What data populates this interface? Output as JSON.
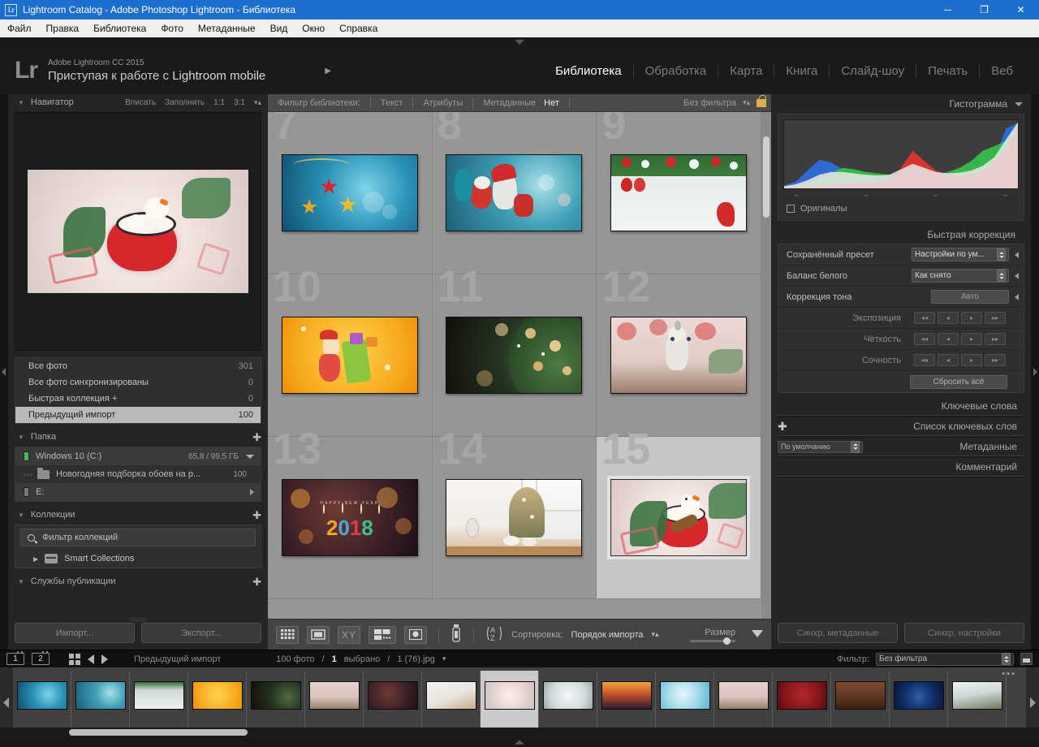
{
  "window": {
    "title": "Lightroom Catalog - Adobe Photoshop Lightroom - Библиотека",
    "app_badge": "Lr",
    "minimize": "─",
    "maximize": "❐",
    "close": "✕"
  },
  "menubar": {
    "items": [
      "Файл",
      "Правка",
      "Библиотека",
      "Фото",
      "Метаданные",
      "Вид",
      "Окно",
      "Справка"
    ]
  },
  "identity": {
    "logo": "Lr",
    "line1": "Adobe Lightroom CC 2015",
    "line2_prefix": "Приступая к работе с ",
    "line2_brand": "Lightroom mobile",
    "arrow": "▶"
  },
  "modules": [
    {
      "label": "Библиотека",
      "active": true
    },
    {
      "label": "Обработка",
      "active": false
    },
    {
      "label": "Карта",
      "active": false
    },
    {
      "label": "Книга",
      "active": false
    },
    {
      "label": "Слайд-шоу",
      "active": false
    },
    {
      "label": "Печать",
      "active": false
    },
    {
      "label": "Веб",
      "active": false
    }
  ],
  "navigator": {
    "title": "Навигатор",
    "zoom_fit": "Вписать",
    "zoom_fill": "Заполнить",
    "zoom_1to1": "1:1",
    "zoom_3to1": "3:1"
  },
  "catalog": {
    "rows": [
      {
        "label": "Все фото",
        "count": "301",
        "selected": false
      },
      {
        "label": "Все фото синхронизированы",
        "count": "0",
        "selected": false
      },
      {
        "label": "Быстрая коллекция  +",
        "count": "0",
        "selected": false
      },
      {
        "label": "Предыдущий импорт",
        "count": "100",
        "selected": true
      }
    ]
  },
  "folders": {
    "title": "Папка",
    "volume": {
      "label": "Windows 10 (C:)",
      "size": "65,8 / 99,5 ГБ"
    },
    "folder": {
      "label": "Новогодняя подборка обоев на р...",
      "count": "100"
    },
    "volume2": {
      "label": "E:"
    }
  },
  "collections": {
    "title": "Коллекции",
    "filter_placeholder": "Фильтр коллекций",
    "smart": "Smart Collections"
  },
  "publish": {
    "title": "Службы публикации"
  },
  "left_buttons": {
    "import": "Импорт...",
    "export": "Экспорт..."
  },
  "library_filter": {
    "label": "Фильтр библиотеки:",
    "text": "Текст",
    "attributes": "Атрибуты",
    "metadata": "Метаданные",
    "none": "Нет",
    "preset": "Без фильтра"
  },
  "grid": {
    "cells": [
      {
        "num": "7",
        "art": "pic7",
        "selected": false
      },
      {
        "num": "8",
        "art": "pic8",
        "selected": false
      },
      {
        "num": "9",
        "art": "pic9",
        "selected": false
      },
      {
        "num": "10",
        "art": "pic10",
        "selected": false
      },
      {
        "num": "11",
        "art": "pic11",
        "selected": false
      },
      {
        "num": "12",
        "art": "pic12",
        "selected": false
      },
      {
        "num": "13",
        "art": "pic13",
        "selected": false
      },
      {
        "num": "14",
        "art": "pic14",
        "selected": false
      },
      {
        "num": "15",
        "art": "pic15",
        "selected": true
      }
    ]
  },
  "toolbar": {
    "grid_view": "grid-view-icon",
    "loupe_view": "loupe-view-icon",
    "compare_view": "compare-view-icon",
    "survey_view": "survey-view-icon",
    "people_view": "people-view-icon",
    "spray": "spray-can-icon",
    "sort_icon": "A–Z",
    "sort_label": "Сортировка:",
    "sort_value": "Порядок импорта",
    "size_label": "Размер"
  },
  "right": {
    "histogram_title": "Гистограмма",
    "originals": "Оригиналы",
    "quick_develop_title": "Быстрая коррекция",
    "saved_preset_label": "Сохранённый пресет",
    "saved_preset_value": "Настройки по ум...",
    "white_balance_label": "Баланс белого",
    "white_balance_value": "Как снято",
    "tone_label": "Коррекция тона",
    "tone_auto": "Авто",
    "exposure_label": "Экспозиция",
    "clarity_label": "Чёткость",
    "vibrance_label": "Сочность",
    "reset_all": "Сбросить всё",
    "keywords_title": "Ключевые слова",
    "keyword_list_title": "Список ключевых слов",
    "metadata_title": "Метаданные",
    "metadata_preset": "По умолчанию",
    "comments_title": "Комментарий",
    "sync_metadata": "Синхр, метаданные",
    "sync_settings": "Синхр, настройки"
  },
  "filmstrip": {
    "screen1": "1",
    "screen2": "2",
    "source": "Предыдущий импорт",
    "photo_count": "100 фото",
    "separator1": "/",
    "selected_count": "1",
    "selected_label": "выбрано",
    "separator2": "/",
    "filename": "1 (76).jpg",
    "filter_label": "Фильтр:",
    "filter_value": "Без фильтра",
    "thumbs": [
      {
        "art": "pic7",
        "selected": false
      },
      {
        "art": "pic8",
        "selected": false
      },
      {
        "art": "pic9",
        "selected": false
      },
      {
        "art": "pic10",
        "selected": false
      },
      {
        "art": "pic11",
        "selected": false
      },
      {
        "art": "pic12",
        "selected": false
      },
      {
        "art": "pic13",
        "selected": false
      },
      {
        "art": "pic14",
        "selected": false
      },
      {
        "art": "pic15",
        "selected": true
      },
      {
        "art": "pic-gift",
        "selected": false
      },
      {
        "art": "pic-sun",
        "selected": false
      },
      {
        "art": "pic-blue",
        "selected": false
      },
      {
        "art": "pic12",
        "selected": false
      },
      {
        "art": "pic-red",
        "selected": false
      },
      {
        "art": "pic-brick",
        "selected": false
      },
      {
        "art": "pic-night",
        "selected": false
      },
      {
        "art": "pic-tree2",
        "selected": false
      }
    ]
  },
  "chart_data": {
    "type": "area",
    "title": "Гистограмма",
    "xlabel": "",
    "ylabel": "",
    "x": [
      0,
      5,
      10,
      15,
      20,
      25,
      30,
      35,
      40,
      45,
      50,
      55,
      60,
      65,
      70,
      75,
      80,
      85,
      90,
      95,
      100
    ],
    "series": [
      {
        "name": "red",
        "values": [
          2,
          3,
          4,
          5,
          6,
          7,
          8,
          9,
          10,
          12,
          30,
          55,
          40,
          26,
          20,
          18,
          20,
          26,
          40,
          58,
          92
        ]
      },
      {
        "name": "green",
        "values": [
          3,
          5,
          8,
          14,
          22,
          30,
          28,
          24,
          22,
          20,
          18,
          17,
          18,
          20,
          24,
          30,
          40,
          55,
          62,
          70,
          95
        ]
      },
      {
        "name": "blue",
        "values": [
          4,
          10,
          26,
          42,
          38,
          28,
          20,
          16,
          14,
          13,
          13,
          14,
          15,
          16,
          18,
          20,
          24,
          30,
          44,
          88,
          96
        ]
      },
      {
        "name": "luminance",
        "values": [
          3,
          6,
          12,
          20,
          24,
          24,
          22,
          20,
          19,
          20,
          28,
          36,
          30,
          24,
          22,
          23,
          26,
          33,
          46,
          72,
          97
        ]
      }
    ],
    "ticks": [
      "–",
      "–",
      "–",
      "–"
    ],
    "grid": false,
    "legend": "none",
    "ylim": [
      0,
      100
    ]
  }
}
